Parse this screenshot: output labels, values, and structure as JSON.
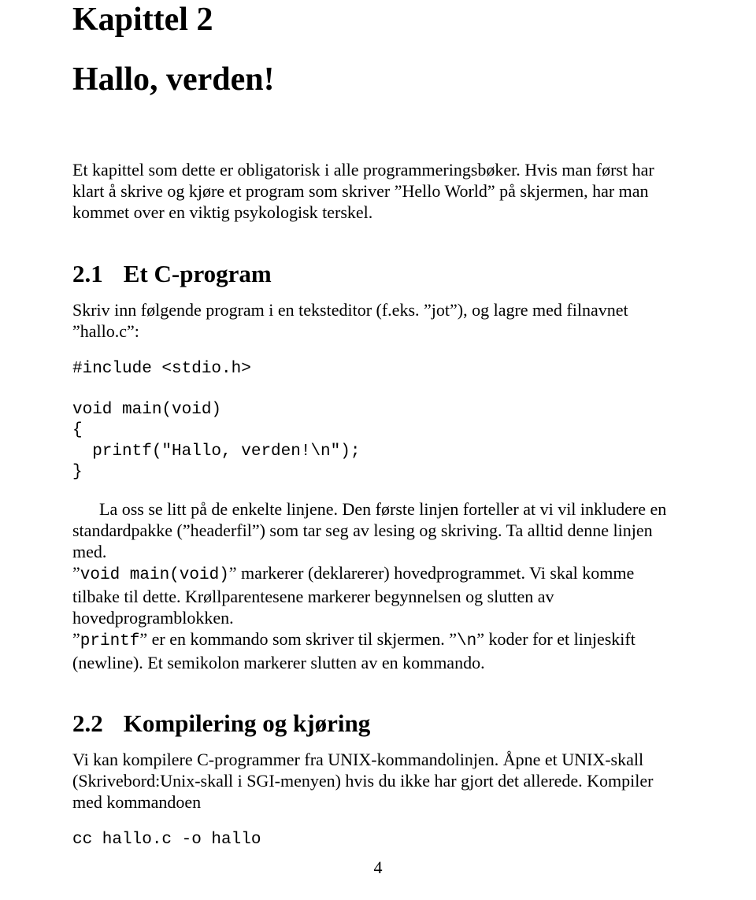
{
  "chapter": {
    "label": "Kapittel 2",
    "title": "Hallo, verden!"
  },
  "intro": "Et kapittel som dette er obligatorisk i alle programmeringsbøker. Hvis man først har klart å skrive og kjøre et program som skriver ”Hello World” på skjermen, har man kommet over en viktig psykologisk terskel.",
  "sections": {
    "s1": {
      "num": "2.1",
      "title": "Et C-program",
      "p1": "Skriv inn følgende program i en teksteditor (f.eks. ”jot”), og lagre med filnavnet ”hallo.c”:",
      "code1": "#include <stdio.h>\n\nvoid main(void)\n{\n  printf(\"Hallo, verden!\\n\");\n}",
      "p2a": "La oss se litt på de enkelte linjene. Den første linjen forteller at vi vil inkludere en standardpakke (”headerfil”) som tar seg av lesing og skriving. Ta alltid denne linjen med.",
      "code_void_main": "void main(void)",
      "p2b": "” markerer (deklarerer) hovedprogrammet. Vi skal komme tilbake til dette. Krøllparentesene markerer begynnelsen og slutten av hovedprogramblokken.",
      "code_printf": "printf",
      "p2c": "” er en kommando som skriver til skjermen. ”",
      "code_newline": "\\n",
      "p2d": "” koder for et linjeskift (newline). Et semikolon markerer slutten av en kommando."
    },
    "s2": {
      "num": "2.2",
      "title": "Kompilering og kjøring",
      "p1": "Vi kan kompilere C-programmer fra UNIX-kommandolinjen. Åpne et UNIX-skall (Skrivebord:Unix-skall i SGI-menyen) hvis du ikke har gjort det allerede. Kompiler med kommandoen",
      "code1": "cc hallo.c -o hallo"
    }
  },
  "page_number": "4"
}
